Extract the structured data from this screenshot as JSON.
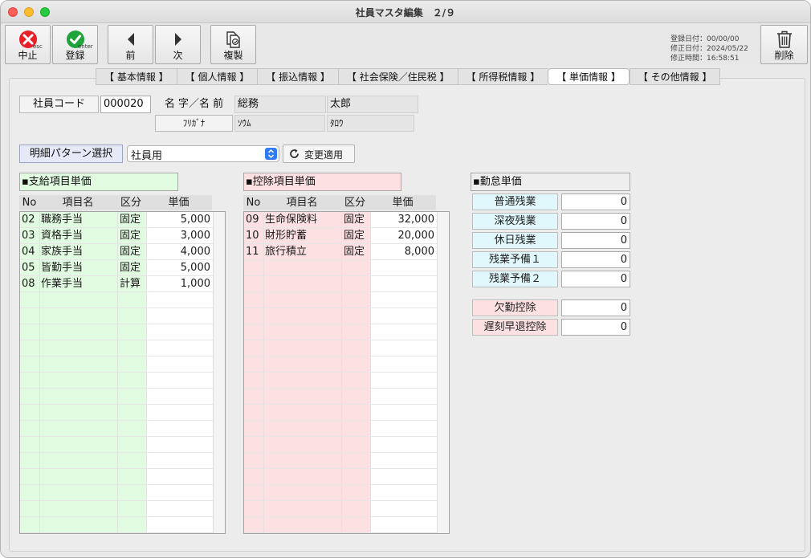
{
  "window": {
    "title": "社員マスタ編集　２/９"
  },
  "toolbar": {
    "cancel_label": "中止",
    "cancel_sub": "esc",
    "register_label": "登録",
    "register_sub": "enter",
    "prev_label": "前",
    "next_label": "次",
    "copy_label": "複製",
    "delete_label": "削除",
    "date_lines": [
      "登録日付：00/00/00",
      "修正日付：2024/05/22",
      "修正時間：16:58:51"
    ]
  },
  "tabs": [
    "【 基本情報 】",
    "【 個人情報 】",
    "【 振込情報 】",
    "【 社会保険／住民税 】",
    "【 所得税情報 】",
    "【 単価情報 】",
    "【 その他情報 】"
  ],
  "active_tab": 5,
  "employee": {
    "code_label": "社員コード",
    "code_value": "000020",
    "name_label": "名 字／名 前",
    "last_name": "総務",
    "first_name": "太郎",
    "kana_label": "ﾌﾘｶﾞﾅ",
    "last_kana": "ｿｳﾑ",
    "first_kana": "ﾀﾛｳ"
  },
  "pattern": {
    "select_button": "明細パターン選択",
    "selected": "社員用",
    "apply_button": "変更適用"
  },
  "payment": {
    "title": "▪支給項目単価",
    "headers": [
      "No",
      "項目名",
      "区分",
      "単価"
    ],
    "rows": [
      [
        "02",
        "職務手当",
        "固定",
        "5,000"
      ],
      [
        "03",
        "資格手当",
        "固定",
        "3,000"
      ],
      [
        "04",
        "家族手当",
        "固定",
        "4,000"
      ],
      [
        "05",
        "皆勤手当",
        "固定",
        "5,000"
      ],
      [
        "08",
        "作業手当",
        "計算",
        "1,000"
      ]
    ]
  },
  "deduction": {
    "title": "▪控除項目単価",
    "headers": [
      "No",
      "項目名",
      "区分",
      "単価"
    ],
    "rows": [
      [
        "09",
        "生命保険料",
        "固定",
        "32,000"
      ],
      [
        "10",
        "財形貯蓄",
        "固定",
        "20,000"
      ],
      [
        "11",
        "旅行積立",
        "固定",
        "8,000"
      ]
    ]
  },
  "attendance": {
    "title": "▪勤怠単価",
    "overtime": [
      {
        "label": "普通残業",
        "value": "0"
      },
      {
        "label": "深夜残業",
        "value": "0"
      },
      {
        "label": "休日残業",
        "value": "0"
      },
      {
        "label": "残業予備１",
        "value": "0"
      },
      {
        "label": "残業予備２",
        "value": "0"
      }
    ],
    "deductions": [
      {
        "label": "欠勤控除",
        "value": "0"
      },
      {
        "label": "遅刻早退控除",
        "value": "0"
      }
    ]
  },
  "colors": {
    "payment_bg": "#e0fbdf",
    "deduction_bg": "#fde1e2",
    "overtime_bg": "#e0f8fc",
    "absence_bg": "#fde1e2",
    "tab_active": "#ffffff",
    "pattern_button": "#e6eaf8"
  }
}
